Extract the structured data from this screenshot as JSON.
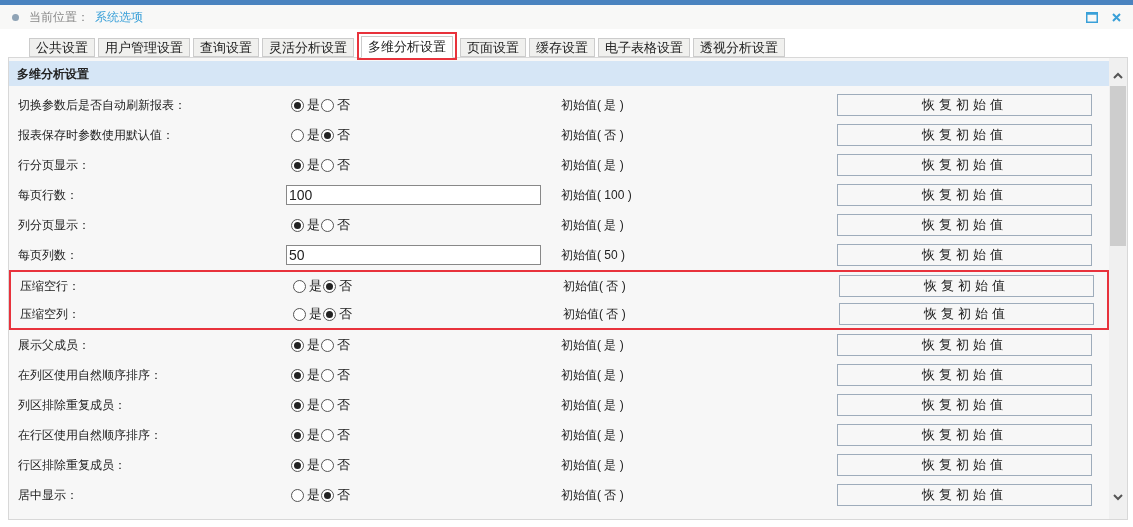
{
  "breadcrumb": {
    "label": "当前位置：",
    "current": "系统选项"
  },
  "tabs": [
    {
      "label": "公共设置",
      "selected": false,
      "highlighted": false
    },
    {
      "label": "用户管理设置",
      "selected": false,
      "highlighted": false
    },
    {
      "label": "查询设置",
      "selected": false,
      "highlighted": false
    },
    {
      "label": "灵活分析设置",
      "selected": false,
      "highlighted": false
    },
    {
      "label": "多维分析设置",
      "selected": true,
      "highlighted": true
    },
    {
      "label": "页面设置",
      "selected": false,
      "highlighted": false
    },
    {
      "label": "缓存设置",
      "selected": false,
      "highlighted": false
    },
    {
      "label": "电子表格设置",
      "selected": false,
      "highlighted": false
    },
    {
      "label": "透视分析设置",
      "selected": false,
      "highlighted": false
    }
  ],
  "section_title": "多维分析设置",
  "settings": [
    {
      "kind": "radio",
      "label": "切换参数后是否自动刷新报表：",
      "options": [
        {
          "label": "是",
          "selected": true
        },
        {
          "label": "否",
          "selected": false
        }
      ],
      "initial": "初始值( 是 )",
      "button": "恢复初始值",
      "highlighted": false
    },
    {
      "kind": "radio",
      "label": "报表保存时参数使用默认值：",
      "options": [
        {
          "label": "是",
          "selected": false
        },
        {
          "label": "否",
          "selected": true
        }
      ],
      "initial": "初始值( 否 )",
      "button": "恢复初始值",
      "highlighted": false
    },
    {
      "kind": "radio",
      "label": "行分页显示：",
      "options": [
        {
          "label": "是",
          "selected": true
        },
        {
          "label": "否",
          "selected": false
        }
      ],
      "initial": "初始值( 是 )",
      "button": "恢复初始值",
      "highlighted": false
    },
    {
      "kind": "text",
      "label": "每页行数：",
      "value": "100",
      "initial": "初始值( 100 )",
      "button": "恢复初始值",
      "highlighted": false
    },
    {
      "kind": "radio",
      "label": "列分页显示：",
      "options": [
        {
          "label": "是",
          "selected": true
        },
        {
          "label": "否",
          "selected": false
        }
      ],
      "initial": "初始值( 是 )",
      "button": "恢复初始值",
      "highlighted": false
    },
    {
      "kind": "text",
      "label": "每页列数：",
      "value": "50",
      "initial": "初始值( 50 )",
      "button": "恢复初始值",
      "highlighted": false
    },
    {
      "kind": "radio",
      "label": "压缩空行：",
      "options": [
        {
          "label": "是",
          "selected": false
        },
        {
          "label": "否",
          "selected": true
        }
      ],
      "initial": "初始值( 否 )",
      "button": "恢复初始值",
      "highlighted": true
    },
    {
      "kind": "radio",
      "label": "压缩空列：",
      "options": [
        {
          "label": "是",
          "selected": false
        },
        {
          "label": "否",
          "selected": true
        }
      ],
      "initial": "初始值( 否 )",
      "button": "恢复初始值",
      "highlighted": true
    },
    {
      "kind": "radio",
      "label": "展示父成员：",
      "options": [
        {
          "label": "是",
          "selected": true
        },
        {
          "label": "否",
          "selected": false
        }
      ],
      "initial": "初始值( 是 )",
      "button": "恢复初始值",
      "highlighted": false
    },
    {
      "kind": "radio",
      "label": "在列区使用自然顺序排序：",
      "options": [
        {
          "label": "是",
          "selected": true
        },
        {
          "label": "否",
          "selected": false
        }
      ],
      "initial": "初始值( 是 )",
      "button": "恢复初始值",
      "highlighted": false
    },
    {
      "kind": "radio",
      "label": "列区排除重复成员：",
      "options": [
        {
          "label": "是",
          "selected": true
        },
        {
          "label": "否",
          "selected": false
        }
      ],
      "initial": "初始值( 是 )",
      "button": "恢复初始值",
      "highlighted": false
    },
    {
      "kind": "radio",
      "label": "在行区使用自然顺序排序：",
      "options": [
        {
          "label": "是",
          "selected": true
        },
        {
          "label": "否",
          "selected": false
        }
      ],
      "initial": "初始值( 是 )",
      "button": "恢复初始值",
      "highlighted": false
    },
    {
      "kind": "radio",
      "label": "行区排除重复成员：",
      "options": [
        {
          "label": "是",
          "selected": true
        },
        {
          "label": "否",
          "selected": false
        }
      ],
      "initial": "初始值( 是 )",
      "button": "恢复初始值",
      "highlighted": false
    },
    {
      "kind": "radio",
      "label": "居中显示：",
      "options": [
        {
          "label": "是",
          "selected": false
        },
        {
          "label": "否",
          "selected": true
        }
      ],
      "initial": "初始值( 否 )",
      "button": "恢复初始值",
      "highlighted": false
    }
  ]
}
